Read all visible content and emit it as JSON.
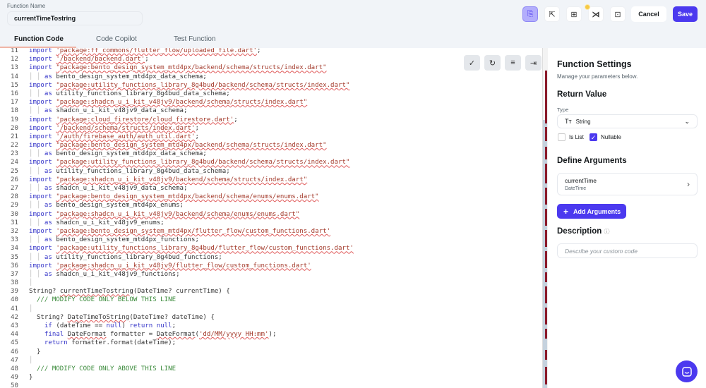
{
  "header": {
    "function_name_label": "Function Name",
    "function_name": "currentTimeTostring",
    "cancel_label": "Cancel",
    "save_label": "Save"
  },
  "tabs": [
    {
      "label": "Function Code"
    },
    {
      "label": "Code Copilot"
    },
    {
      "label": "Test Function"
    }
  ],
  "editor": {
    "lines": [
      {
        "n": "11",
        "tokens": [
          [
            "import ",
            "k"
          ],
          [
            "'package:ff_commons/flutter_flow/uploaded_file.dart'",
            "s"
          ],
          [
            ";",
            "t"
          ]
        ]
      },
      {
        "n": "12",
        "tokens": [
          [
            "import ",
            "k"
          ],
          [
            "'/backend/backend.dart'",
            "s"
          ],
          [
            ";",
            "t"
          ]
        ]
      },
      {
        "n": "13",
        "tokens": [
          [
            "import ",
            "k"
          ],
          [
            "\"package:bento_design_system_mtd4px/backend/schema/structs/index.dart\"",
            "s"
          ]
        ]
      },
      {
        "n": "14",
        "tokens": [
          [
            "│ │ ",
            "g"
          ],
          [
            "as ",
            "k"
          ],
          [
            "bento_design_system_mtd4px_data_schema;",
            "t"
          ]
        ]
      },
      {
        "n": "15",
        "tokens": [
          [
            "import ",
            "k"
          ],
          [
            "\"package:utility_functions_library_8g4bud/backend/schema/structs/index.dart\"",
            "s"
          ]
        ]
      },
      {
        "n": "16",
        "tokens": [
          [
            "│ │ ",
            "g"
          ],
          [
            "as ",
            "k"
          ],
          [
            "utility_functions_library_8g4bud_data_schema;",
            "t"
          ]
        ]
      },
      {
        "n": "17",
        "tokens": [
          [
            "import ",
            "k"
          ],
          [
            "\"package:shadcn_u_i_kit_v48jv9/backend/schema/structs/index.dart\"",
            "s"
          ]
        ]
      },
      {
        "n": "18",
        "tokens": [
          [
            "│ │ ",
            "g"
          ],
          [
            "as ",
            "k"
          ],
          [
            "shadcn_u_i_kit_v48jv9_data_schema;",
            "t"
          ]
        ]
      },
      {
        "n": "19",
        "tokens": [
          [
            "import ",
            "k"
          ],
          [
            "'package:cloud_firestore/cloud_firestore.dart'",
            "s"
          ],
          [
            ";",
            "t"
          ]
        ]
      },
      {
        "n": "20",
        "tokens": [
          [
            "import ",
            "k"
          ],
          [
            "'/backend/schema/structs/index.dart'",
            "s"
          ],
          [
            ";",
            "t"
          ]
        ]
      },
      {
        "n": "21",
        "tokens": [
          [
            "import ",
            "k"
          ],
          [
            "'/auth/firebase_auth/auth_util.dart'",
            "s"
          ],
          [
            ";",
            "t"
          ]
        ]
      },
      {
        "n": "22",
        "tokens": [
          [
            "import ",
            "k"
          ],
          [
            "\"package:bento_design_system_mtd4px/backend/schema/structs/index.dart\"",
            "s"
          ]
        ]
      },
      {
        "n": "23",
        "tokens": [
          [
            "│ │ ",
            "g"
          ],
          [
            "as ",
            "k"
          ],
          [
            "bento_design_system_mtd4px_data_schema;",
            "t"
          ]
        ]
      },
      {
        "n": "24",
        "tokens": [
          [
            "import ",
            "k"
          ],
          [
            "\"package:utility_functions_library_8g4bud/backend/schema/structs/index.dart\"",
            "s"
          ]
        ]
      },
      {
        "n": "25",
        "tokens": [
          [
            "│ │ ",
            "g"
          ],
          [
            "as ",
            "k"
          ],
          [
            "utility_functions_library_8g4bud_data_schema;",
            "t"
          ]
        ]
      },
      {
        "n": "26",
        "tokens": [
          [
            "import ",
            "k"
          ],
          [
            "\"package:shadcn_u_i_kit_v48jv9/backend/schema/structs/index.dart\"",
            "s"
          ]
        ]
      },
      {
        "n": "27",
        "tokens": [
          [
            "│ │ ",
            "g"
          ],
          [
            "as ",
            "k"
          ],
          [
            "shadcn_u_i_kit_v48jv9_data_schema;",
            "t"
          ]
        ]
      },
      {
        "n": "28",
        "tokens": [
          [
            "import ",
            "k"
          ],
          [
            "\"package:bento_design_system_mtd4px/backend/schema/enums/enums.dart\"",
            "s"
          ]
        ]
      },
      {
        "n": "29",
        "tokens": [
          [
            "│ │ ",
            "g"
          ],
          [
            "as ",
            "k"
          ],
          [
            "bento_design_system_mtd4px_enums;",
            "t"
          ]
        ]
      },
      {
        "n": "30",
        "tokens": [
          [
            "import ",
            "k"
          ],
          [
            "\"package:shadcn_u_i_kit_v48jv9/backend/schema/enums/enums.dart\"",
            "s"
          ]
        ]
      },
      {
        "n": "31",
        "tokens": [
          [
            "│ │ ",
            "g"
          ],
          [
            "as ",
            "k"
          ],
          [
            "shadcn_u_i_kit_v48jv9_enums;",
            "t"
          ]
        ]
      },
      {
        "n": "32",
        "tokens": [
          [
            "import ",
            "k"
          ],
          [
            "'package:bento_design_system_mtd4px/flutter_flow/custom_functions.dart'",
            "s"
          ]
        ]
      },
      {
        "n": "33",
        "tokens": [
          [
            "│ │ ",
            "g"
          ],
          [
            "as ",
            "k"
          ],
          [
            "bento_design_system_mtd4px_functions;",
            "t"
          ]
        ]
      },
      {
        "n": "34",
        "tokens": [
          [
            "import ",
            "k"
          ],
          [
            "'package:utility_functions_library_8g4bud/flutter_flow/custom_functions.dart'",
            "s"
          ]
        ]
      },
      {
        "n": "35",
        "tokens": [
          [
            "│ │ ",
            "g"
          ],
          [
            "as ",
            "k"
          ],
          [
            "utility_functions_library_8g4bud_functions;",
            "t"
          ]
        ]
      },
      {
        "n": "36",
        "tokens": [
          [
            "import ",
            "k"
          ],
          [
            "'package:shadcn_u_i_kit_v48jv9/flutter_flow/custom_functions.dart'",
            "s"
          ]
        ]
      },
      {
        "n": "37",
        "tokens": [
          [
            "│ │ ",
            "g"
          ],
          [
            "as ",
            "k"
          ],
          [
            "shadcn_u_i_kit_v48jv9_functions;",
            "t"
          ]
        ]
      },
      {
        "n": "38",
        "tokens": [
          [
            "│",
            "g"
          ]
        ]
      },
      {
        "n": "39",
        "tokens": [
          [
            "String? ",
            "t"
          ],
          [
            "currentTimeTostring",
            "e"
          ],
          [
            "(DateTime? currentTime) {",
            "t"
          ]
        ]
      },
      {
        "n": "40",
        "tokens": [
          [
            "  /// MODIFY CODE ONLY BELOW THIS LINE",
            "c"
          ]
        ]
      },
      {
        "n": "41",
        "tokens": [
          [
            "│",
            "g"
          ]
        ]
      },
      {
        "n": "42",
        "tokens": [
          [
            "  String? ",
            "t"
          ],
          [
            "DateTimeToString",
            "e"
          ],
          [
            "(DateTime? dateTime) {",
            "t"
          ]
        ]
      },
      {
        "n": "43",
        "tokens": [
          [
            "    ",
            "t"
          ],
          [
            "if ",
            "k"
          ],
          [
            "(dateTime == ",
            "t"
          ],
          [
            "null",
            "k"
          ],
          [
            ") ",
            "t"
          ],
          [
            "return null",
            "k"
          ],
          [
            ";",
            "t"
          ]
        ]
      },
      {
        "n": "44",
        "tokens": [
          [
            "    ",
            "t"
          ],
          [
            "final ",
            "k"
          ],
          [
            "DateFormat",
            "e"
          ],
          [
            " formatter = ",
            "t"
          ],
          [
            "DateFormat",
            "e"
          ],
          [
            "(",
            "t"
          ],
          [
            "'dd/MM/yyyy HH:mm'",
            "s"
          ],
          [
            ");",
            "t"
          ]
        ]
      },
      {
        "n": "45",
        "tokens": [
          [
            "    ",
            "t"
          ],
          [
            "return ",
            "k"
          ],
          [
            "formatter.format(dateTime);",
            "t"
          ]
        ]
      },
      {
        "n": "46",
        "tokens": [
          [
            "  }",
            "t"
          ]
        ]
      },
      {
        "n": "47",
        "tokens": [
          [
            "│",
            "g"
          ]
        ]
      },
      {
        "n": "48",
        "tokens": [
          [
            "  /// MODIFY CODE ONLY ABOVE THIS LINE",
            "c"
          ]
        ]
      },
      {
        "n": "49",
        "tokens": [
          [
            "}",
            "t"
          ]
        ]
      },
      {
        "n": "50",
        "tokens": []
      }
    ]
  },
  "settings": {
    "title": "Function Settings",
    "subtitle": "Manage your parameters below.",
    "return_value": "Return Value",
    "type_label": "Type",
    "type_value": "String",
    "is_list": "Is List",
    "nullable": "Nullable",
    "is_list_checked": false,
    "nullable_checked": true,
    "define_arguments": "Define Arguments",
    "arguments": [
      {
        "name": "currentTime",
        "type": "DateTime"
      }
    ],
    "add_arguments": "Add Arguments",
    "description": "Description",
    "description_placeholder": "Describe your custom code"
  },
  "colors": {
    "accent": "#4b39ef",
    "header_bg": "#f1f4f8"
  }
}
